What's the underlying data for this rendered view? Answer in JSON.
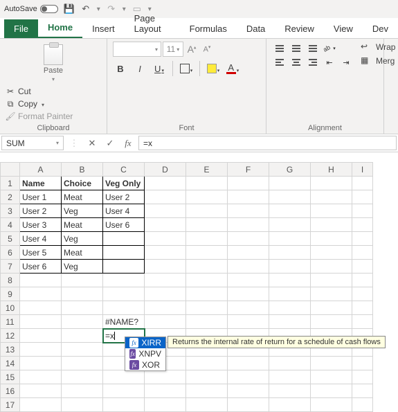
{
  "titlebar": {
    "autosave_label": "AutoSave",
    "autosave_on": false,
    "save_icon": "save-icon",
    "undo_icon": "undo-icon",
    "redo_icon": "redo-icon"
  },
  "tabs": {
    "file": "File",
    "items": [
      "Home",
      "Insert",
      "Page Layout",
      "Formulas",
      "Data",
      "Review",
      "View",
      "Dev"
    ],
    "active_index": 0
  },
  "ribbon": {
    "clipboard": {
      "paste": "Paste",
      "cut": "Cut",
      "copy": "Copy",
      "format_painter": "Format Painter",
      "label": "Clipboard"
    },
    "font": {
      "name_placeholder": "",
      "size_placeholder": "11",
      "bold": "B",
      "italic": "I",
      "underline": "U",
      "label": "Font"
    },
    "alignment": {
      "wrap": "Wrap",
      "merge": "Merg",
      "label": "Alignment"
    }
  },
  "formula_bar": {
    "name_box": "SUM",
    "formula": "=x"
  },
  "grid": {
    "columns": [
      "A",
      "B",
      "C",
      "D",
      "E",
      "F",
      "G",
      "H",
      "I"
    ],
    "row_count": 17,
    "headers": {
      "A": "Name",
      "B": "Choice",
      "C": "Veg Only"
    },
    "data": [
      {
        "A": "User 1",
        "B": "Meat",
        "C": "User 2"
      },
      {
        "A": "User 2",
        "B": "Veg",
        "C": "User 4"
      },
      {
        "A": "User 3",
        "B": "Meat",
        "C": "User 6"
      },
      {
        "A": "User 4",
        "B": "Veg",
        "C": ""
      },
      {
        "A": "User 5",
        "B": "Meat",
        "C": ""
      },
      {
        "A": "User 6",
        "B": "Veg",
        "C": ""
      }
    ],
    "error_cell": {
      "row": 11,
      "col": "C",
      "value": "#NAME?"
    },
    "editing_cell": {
      "row": 12,
      "col": "C",
      "value": "=x"
    }
  },
  "autocomplete": {
    "items": [
      "XIRR",
      "XNPV",
      "XOR"
    ],
    "selected_index": 0,
    "tooltip": "Returns the internal rate of return for a schedule of cash flows"
  }
}
